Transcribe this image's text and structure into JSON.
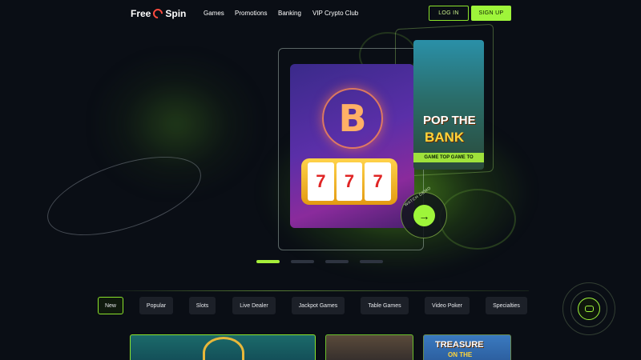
{
  "header": {
    "logo": "Free",
    "logo_suffix": "Spin",
    "nav": [
      "Games",
      "Promotions",
      "Banking",
      "VIP Crypto Club"
    ],
    "login": "LOG IN",
    "signup": "SIGN UP"
  },
  "hero": {
    "slot_card": {
      "bitcoin_symbol": "B",
      "reels": [
        "7",
        "7",
        "7"
      ]
    },
    "game_card": {
      "title_line1": "POP THE",
      "title_line2": "BANK",
      "tag": "GAME TOP GAME TO"
    },
    "demo": {
      "label": "WATCH DEMO",
      "arrow": "→"
    },
    "pager": {
      "count": 4,
      "active_index": 0
    }
  },
  "tabs": {
    "items": [
      "New",
      "Popular",
      "Slots",
      "Live Dealer",
      "Jackpot Games",
      "Table Games",
      "Video Poker",
      "Specialties"
    ],
    "active": "New"
  },
  "games": [
    {
      "title": ""
    },
    {
      "title": ""
    },
    {
      "title": "TREASURE",
      "subtitle": "ON THE"
    }
  ],
  "colors": {
    "accent": "#9ef53a",
    "background": "#0a0e15",
    "tab_bg": "#1c2028"
  },
  "icons": {
    "chat": "chat-icon",
    "logo": "spin-logo-icon"
  }
}
